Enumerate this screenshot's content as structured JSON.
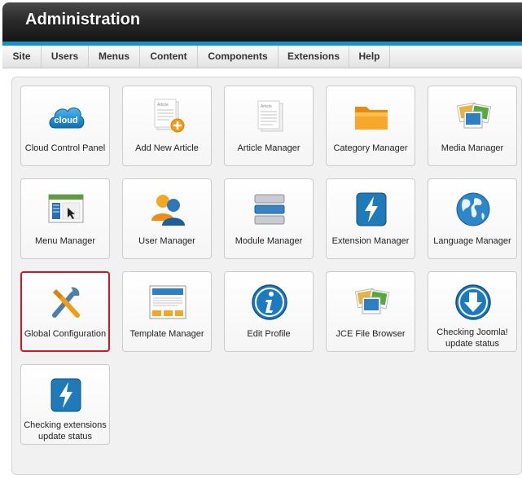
{
  "header": {
    "title": "Administration",
    "accent": "#1592c9"
  },
  "menu": [
    {
      "label": "Site"
    },
    {
      "label": "Users"
    },
    {
      "label": "Menus"
    },
    {
      "label": "Content"
    },
    {
      "label": "Components"
    },
    {
      "label": "Extensions"
    },
    {
      "label": "Help"
    }
  ],
  "icons": {
    "cloud_text": "cloud",
    "article_text": "Article"
  },
  "tiles": [
    {
      "label": "Cloud Control Panel",
      "icon": "cloud-icon"
    },
    {
      "label": "Add New Article",
      "icon": "add-article-icon"
    },
    {
      "label": "Article Manager",
      "icon": "article-icon"
    },
    {
      "label": "Category Manager",
      "icon": "folder-icon"
    },
    {
      "label": "Media Manager",
      "icon": "media-icon"
    },
    {
      "label": "Menu Manager",
      "icon": "menu-manager-icon"
    },
    {
      "label": "User Manager",
      "icon": "users-icon"
    },
    {
      "label": "Module Manager",
      "icon": "module-icon"
    },
    {
      "label": "Extension Manager",
      "icon": "extension-icon"
    },
    {
      "label": "Language Manager",
      "icon": "globe-icon"
    },
    {
      "label": "Global Configuration",
      "icon": "tools-icon",
      "selected": true
    },
    {
      "label": "Template Manager",
      "icon": "template-icon"
    },
    {
      "label": "Edit Profile",
      "icon": "info-icon"
    },
    {
      "label": "JCE File Browser",
      "icon": "media-icon"
    },
    {
      "label": "Checking Joomla! update status",
      "icon": "download-icon"
    },
    {
      "label": "Checking extensions update status",
      "icon": "extension-icon"
    }
  ]
}
